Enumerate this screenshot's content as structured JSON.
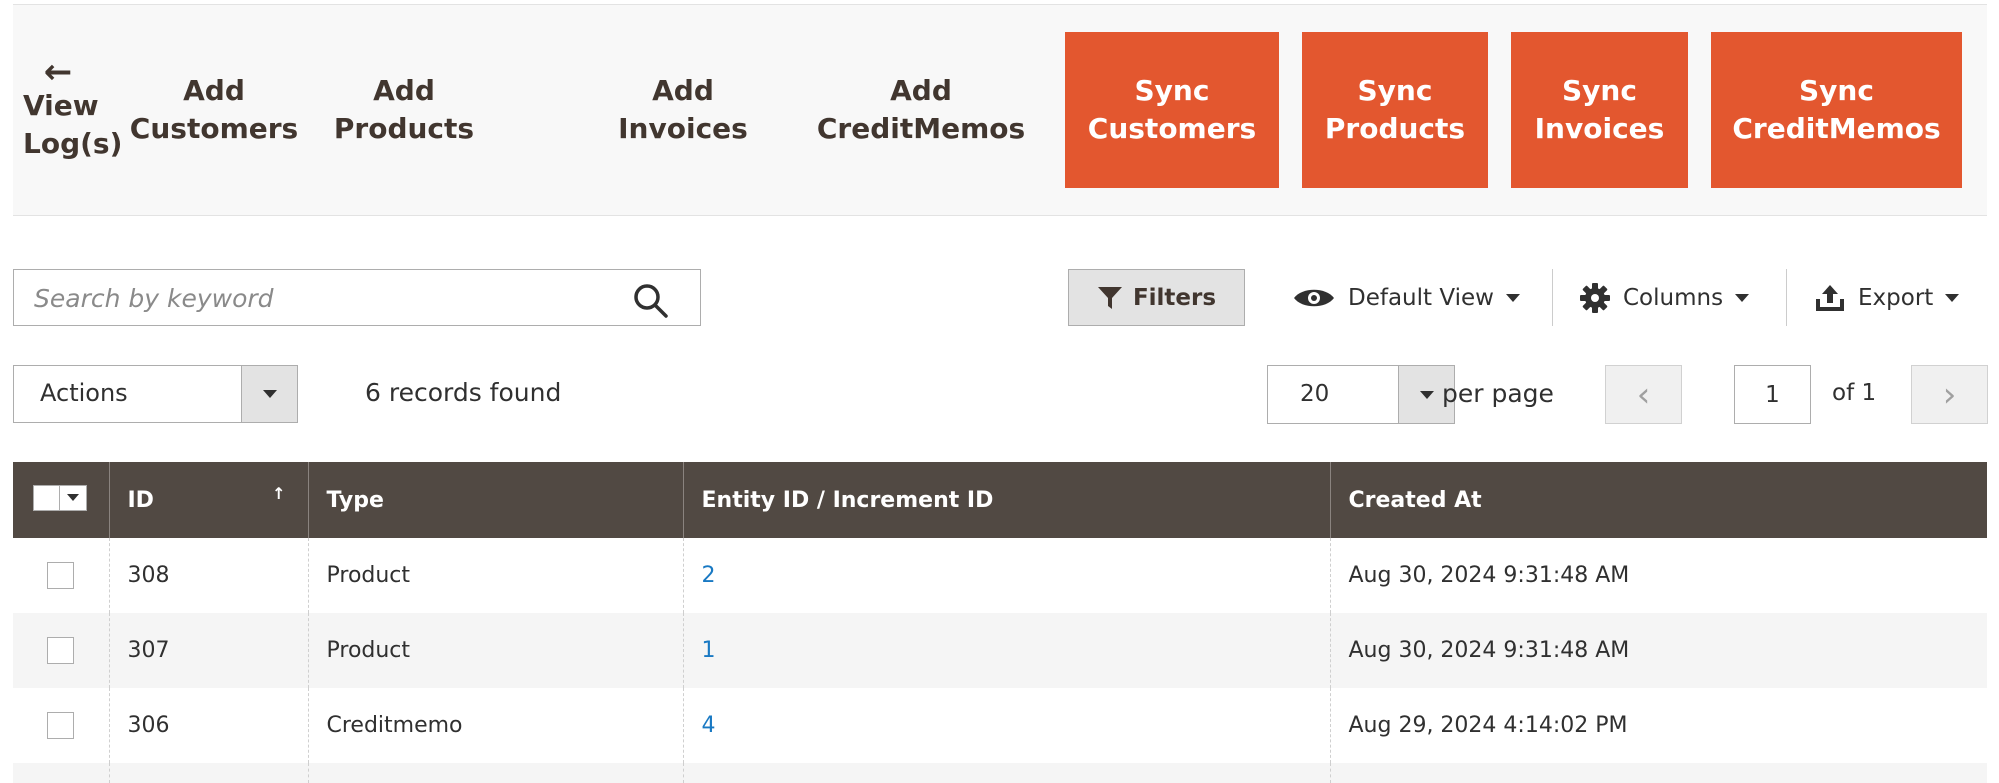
{
  "toolbar": {
    "back_label": "View Log(s)",
    "buttons": [
      {
        "label": "Add Customers"
      },
      {
        "label": "Add Products"
      },
      {
        "label": "Add Invoices"
      },
      {
        "label": "Add CreditMemos"
      },
      {
        "label": "Sync Customers"
      },
      {
        "label": "Sync Products"
      },
      {
        "label": "Sync Invoices"
      },
      {
        "label": "Sync CreditMemos"
      }
    ]
  },
  "colors": {
    "accent": "#e3572f",
    "header_bg": "#514943",
    "link": "#1979c3"
  },
  "search": {
    "placeholder": "Search by keyword",
    "value": ""
  },
  "controls": {
    "filters_label": "Filters",
    "view_label": "Default View",
    "columns_label": "Columns",
    "export_label": "Export"
  },
  "actions": {
    "label": "Actions"
  },
  "records_found": "6 records found",
  "pagination": {
    "per_page_value": "20",
    "per_page_label": "per page",
    "current_page": "1",
    "of_label": "of 1"
  },
  "grid": {
    "columns": [
      "ID",
      "Type",
      "Entity ID / Increment ID",
      "Created At"
    ],
    "sort_indicator": "↑",
    "rows": [
      {
        "id": "308",
        "type": "Product",
        "entity": "2",
        "created": "Aug 30, 2024 9:31:48 AM"
      },
      {
        "id": "307",
        "type": "Product",
        "entity": "1",
        "created": "Aug 30, 2024 9:31:48 AM"
      },
      {
        "id": "306",
        "type": "Creditmemo",
        "entity": "4",
        "created": "Aug 29, 2024 4:14:02 PM"
      }
    ]
  },
  "icons": [
    "arrow-left-icon",
    "search-icon",
    "filter-icon",
    "eye-icon",
    "gear-icon",
    "export-icon",
    "chevron-left-icon",
    "chevron-right-icon",
    "caret-down-icon"
  ]
}
